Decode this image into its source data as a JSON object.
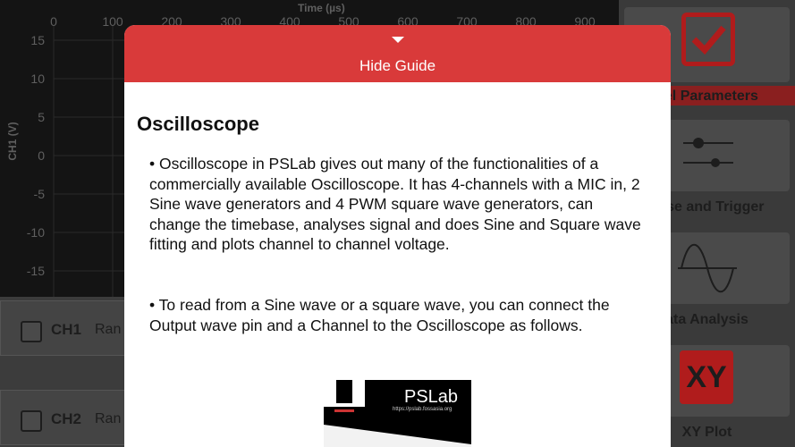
{
  "plot": {
    "x_axis_title": "Time  (µs)",
    "y_axis_title": "CH1  (V)",
    "x_ticks": [
      "0",
      "100",
      "200",
      "300",
      "400",
      "500",
      "600",
      "700",
      "800",
      "900"
    ],
    "y_ticks": [
      "15",
      "10",
      "5",
      "0",
      "-5",
      "-10",
      "-15"
    ]
  },
  "channels": [
    {
      "name": "CH1",
      "range_label": "Ran"
    },
    {
      "name": "CH2",
      "range_label": "Ran"
    }
  ],
  "side_panel": {
    "items": [
      {
        "label": "nel Parameters",
        "icon": "checkbox-checked-icon"
      },
      {
        "label": "base and Trigger",
        "icon": "sliders-icon"
      },
      {
        "label": "ata Analysis",
        "icon": "sine-wave-icon"
      },
      {
        "label": "XY Plot",
        "icon": "xy-icon",
        "badge": "XY"
      }
    ]
  },
  "guide": {
    "hide_label": "Hide Guide",
    "title": "Oscilloscope",
    "paragraphs": [
      "• Oscilloscope in PSLab gives out many of the functionalities of a commercially available Oscilloscope. It has 4-channels with a MIC in, 2 Sine wave generators and 4 PWM square wave generators, can change the timebase, analyses signal and does Sine and Square wave fitting and plots channel to channel voltage.",
      "• To read from a Sine wave or a square wave, you can connect the Output wave pin and a Channel to the Oscilloscope as follows."
    ],
    "image": {
      "title": "PSLab",
      "url": "https://pslab.fossasia.org"
    }
  },
  "colors": {
    "accent": "#d93a3a",
    "plot_bg": "#141414"
  }
}
